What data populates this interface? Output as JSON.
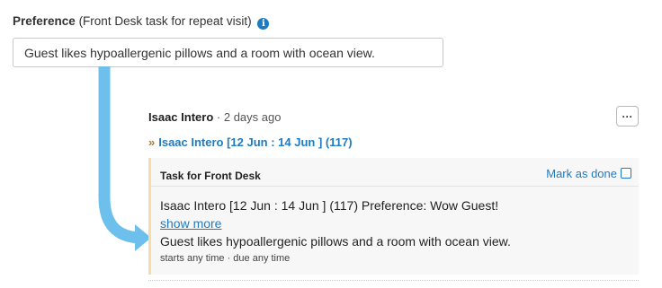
{
  "preference": {
    "label_bold": "Preference",
    "label_rest": "(Front Desk task for repeat visit)",
    "info_icon": "info-circle-icon",
    "value": "Guest likes hypoallergenic pillows and a room with ocean view."
  },
  "entry": {
    "author": "Isaac Intero",
    "separator": "·",
    "time": "2 days ago",
    "menu_label": "···",
    "ref_prefix": "»",
    "ref_link": "Isaac Intero [12 Jun : 14 Jun ] (117)"
  },
  "task": {
    "title": "Task for Front Desk",
    "mark_done": "Mark as done",
    "line1": "Isaac Intero [12 Jun : 14 Jun ] (117) Preference: Wow Guest!",
    "show_more": "show more",
    "line2": "Guest likes hypoallergenic pillows and a room with ocean view.",
    "meta": "starts any time · due any time"
  },
  "colors": {
    "accent": "#1f7bc1",
    "arrow": "#6ec0ec",
    "task_border": "#f5dca5",
    "task_bg": "#f7f7f7"
  }
}
